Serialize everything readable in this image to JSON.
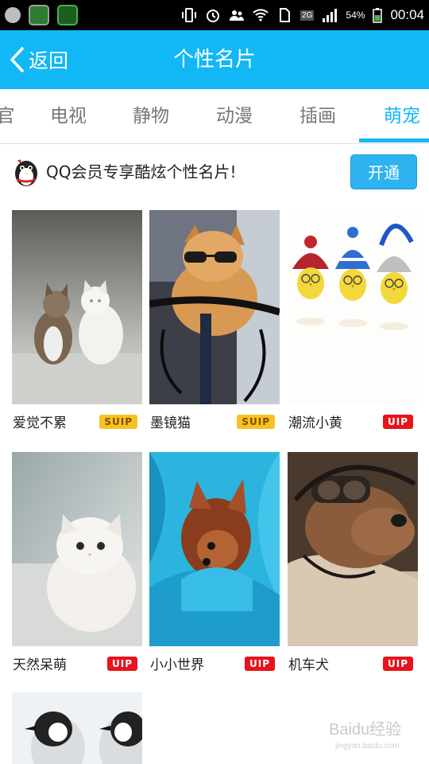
{
  "status_bar": {
    "battery": "54%",
    "network": "2G",
    "time": "00:04",
    "icons": [
      "notification-icon",
      "app-icon",
      "app-icon",
      "vibrate-icon",
      "alarm-icon",
      "contacts-icon",
      "wifi-icon",
      "sim-icon",
      "signal-icon",
      "battery-icon"
    ]
  },
  "header": {
    "back_label": "返回",
    "title": "个性名片"
  },
  "tabs": [
    "官",
    "电视",
    "静物",
    "动漫",
    "插画",
    "萌宠"
  ],
  "active_tab": "萌宠",
  "banner": {
    "text": "QQ会员专享酷炫个性名片!",
    "button_label": "开通",
    "icon": "qq-penguin-icon"
  },
  "cards": [
    {
      "name": "爱觉不累",
      "badge": "SUIP",
      "badge_type": "svip"
    },
    {
      "name": "墨镜猫",
      "badge": "SUIP",
      "badge_type": "svip"
    },
    {
      "name": "潮流小黄",
      "badge": "UIP",
      "badge_type": "vip"
    },
    {
      "name": "天然呆萌",
      "badge": "UIP",
      "badge_type": "vip"
    },
    {
      "name": "小小世界",
      "badge": "UIP",
      "badge_type": "vip"
    },
    {
      "name": "机车犬",
      "badge": "UIP",
      "badge_type": "vip"
    }
  ],
  "watermark": {
    "text": "Baidu经验",
    "sub": "jingyan.baidu.com"
  },
  "colors": {
    "accent": "#12b7f5",
    "svip_badge": "#f6c223",
    "vip_badge": "#e8131b"
  }
}
